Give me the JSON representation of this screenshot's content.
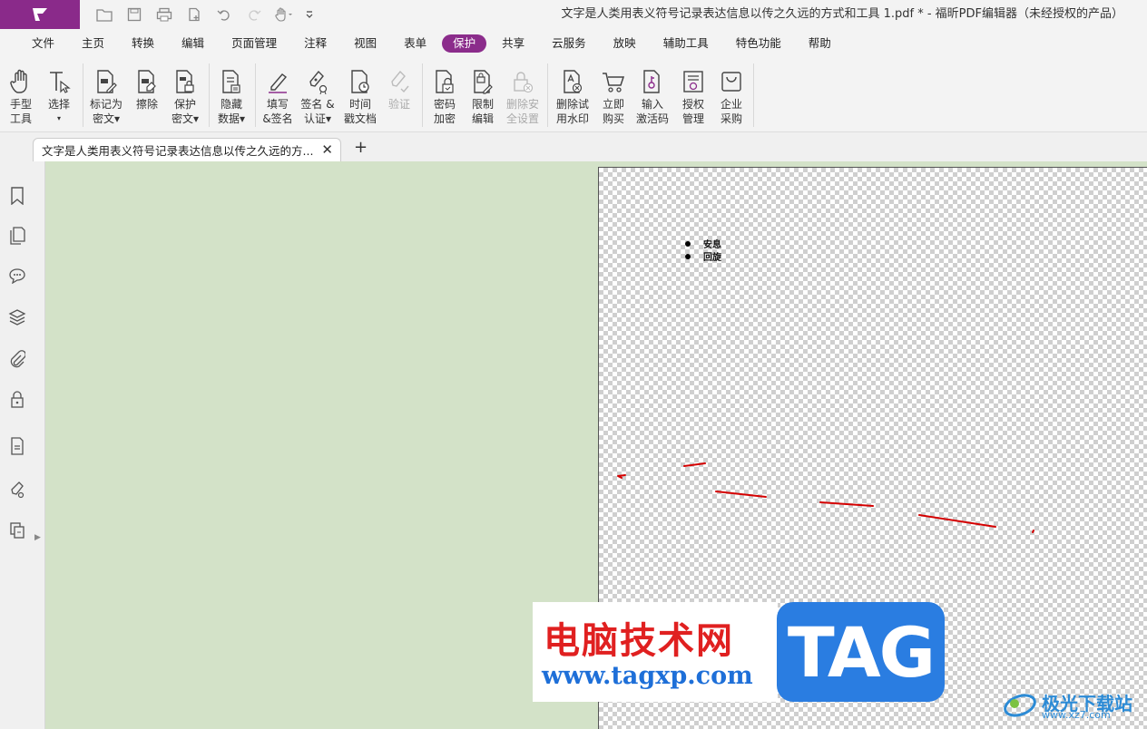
{
  "window": {
    "title": "文字是人类用表义符号记录表达信息以传之久远的方式和工具 1.pdf * - 福昕PDF编辑器（未经授权的产品）"
  },
  "menu": [
    {
      "label": "文件"
    },
    {
      "label": "主页"
    },
    {
      "label": "转换"
    },
    {
      "label": "编辑"
    },
    {
      "label": "页面管理"
    },
    {
      "label": "注释"
    },
    {
      "label": "视图"
    },
    {
      "label": "表单"
    },
    {
      "label": "保护",
      "active": true
    },
    {
      "label": "共享"
    },
    {
      "label": "云服务"
    },
    {
      "label": "放映"
    },
    {
      "label": "辅助工具"
    },
    {
      "label": "特色功能"
    },
    {
      "label": "帮助"
    }
  ],
  "ribbon": {
    "hand": {
      "l1": "手型",
      "l2": "工具"
    },
    "select": {
      "l1": "选择",
      "l2": "▾"
    },
    "mark_redact": {
      "l1": "标记为",
      "l2": "密文▾"
    },
    "erase": {
      "l1": "擦除"
    },
    "protect_redact": {
      "l1": "保护",
      "l2": "密文▾"
    },
    "hide_data": {
      "l1": "隐藏",
      "l2": "数据▾"
    },
    "fill_sign": {
      "l1": "填写",
      "l2": "&签名"
    },
    "sign_certify": {
      "l1": "签名 &",
      "l2": "认证▾"
    },
    "timestamp": {
      "l1": "时间",
      "l2": "戳文档"
    },
    "validate": {
      "l1": "验证"
    },
    "password_encrypt": {
      "l1": "密码",
      "l2": "加密"
    },
    "restrict_edit": {
      "l1": "限制",
      "l2": "编辑"
    },
    "remove_security": {
      "l1": "删除安",
      "l2": "全设置"
    },
    "remove_trial_wm": {
      "l1": "删除试",
      "l2": "用水印"
    },
    "buy_now": {
      "l1": "立即",
      "l2": "购买"
    },
    "enter_code": {
      "l1": "输入",
      "l2": "激活码"
    },
    "license_mgmt": {
      "l1": "授权",
      "l2": "管理"
    },
    "enterprise": {
      "l1": "企业",
      "l2": "采购"
    }
  },
  "tab": {
    "label": "文字是人类用表义符号记录表达信息以传之久远的方...",
    "close": "✕",
    "new": "+"
  },
  "document": {
    "bullets": [
      "安息",
      "回旋"
    ]
  },
  "watermark": {
    "cn_text": "电脑技术网",
    "url": "www.tagxp.com",
    "tag": "TAG",
    "site_name": "极光下载站",
    "site_url": "www.xz7.com"
  },
  "colors": {
    "accent": "#8b2c8b",
    "workspace": "#d3e2c8",
    "ink": "#d40000"
  }
}
